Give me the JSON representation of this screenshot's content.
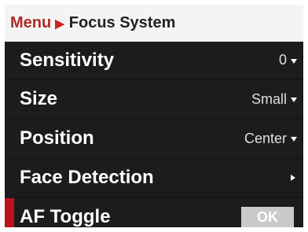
{
  "breadcrumb": {
    "root": "Menu",
    "separator_icon": "chevron-right-icon",
    "current": "Focus System"
  },
  "colors": {
    "accent": "#c0121c",
    "panel": "#161616",
    "header_bg": "#f4f4f4"
  },
  "menu": {
    "sensitivity": {
      "label": "Sensitivity",
      "value": "0",
      "icon": "caret-down-icon"
    },
    "size": {
      "label": "Size",
      "value": "Small",
      "icon": "caret-down-icon"
    },
    "position": {
      "label": "Position",
      "value": "Center",
      "icon": "caret-down-icon"
    },
    "face_detection": {
      "label": "Face Detection",
      "icon": "caret-right-icon"
    },
    "af_toggle": {
      "label": "AF Toggle",
      "button": "OK",
      "selected": true
    }
  }
}
